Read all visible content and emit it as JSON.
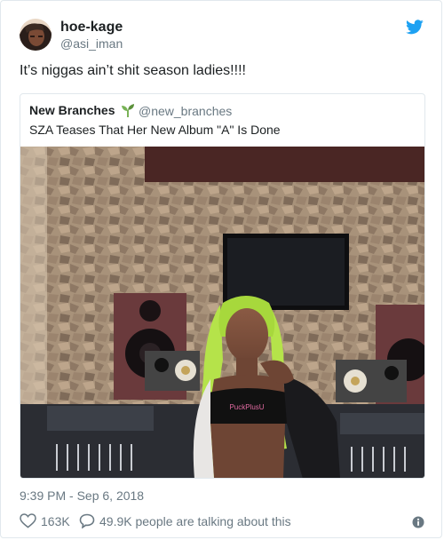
{
  "tweet": {
    "author_name": "hoe-kage",
    "author_handle": "@asi_iman",
    "text": "It’s niggas ain’t shit season ladies!!!!",
    "timestamp": "9:39 PM - Sep 6, 2018",
    "like_count": "163K",
    "talking_text": "49.9K people are talking about this"
  },
  "quoted_tweet": {
    "author_name": "New Branches",
    "author_handle": "@new_branches",
    "text": "SZA Teases That Her New Album \"A\" Is Done",
    "shirt_text": "PuckPlusU"
  },
  "colors": {
    "twitter_blue": "#1da1f2",
    "muted_text": "#697882",
    "border": "#e1e8ed",
    "hair": "#b5e34a"
  },
  "icons": {
    "logo": "twitter-bird-icon",
    "verified_emoji": "seedling-icon",
    "like": "heart-icon",
    "reply": "speech-bubble-icon",
    "info": "info-icon"
  }
}
